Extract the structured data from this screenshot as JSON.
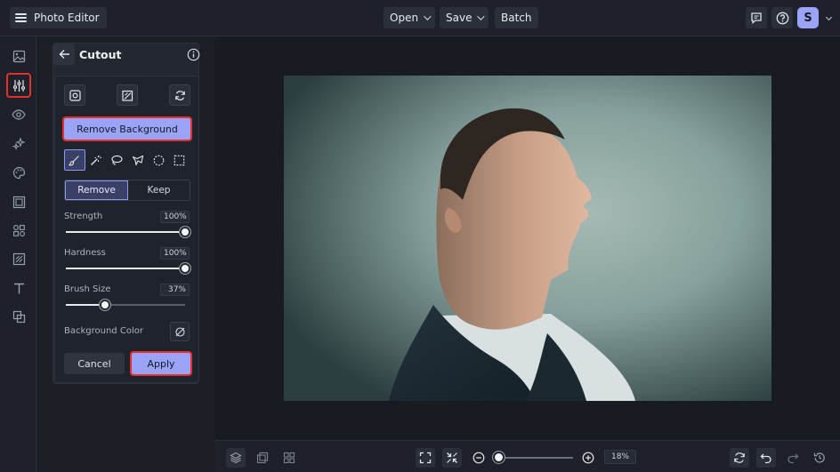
{
  "app": {
    "title": "Photo Editor"
  },
  "topbar": {
    "open_label": "Open",
    "save_label": "Save",
    "batch_label": "Batch",
    "avatar_letter": "S",
    "icons": [
      "menu-icon",
      "chat-icon",
      "help-icon",
      "chevron-down-icon"
    ]
  },
  "rail": {
    "items": [
      "image-icon",
      "adjustments-icon",
      "eye-icon",
      "sparkle-effects-icon",
      "palette-icon",
      "frame-icon",
      "shapes-icon",
      "texture-icon",
      "text-icon",
      "overlay-icon"
    ],
    "active": "adjustments-icon"
  },
  "panel": {
    "title": "Cutout",
    "mode_icons": [
      "instagram-square-icon",
      "auto-cutout-icon",
      "refresh-icon"
    ],
    "remove_background_label": "Remove Background",
    "tools": [
      "brush-icon",
      "magic-wand-icon",
      "lasso-icon",
      "polygon-lasso-icon",
      "ellipse-select-icon",
      "rect-select-icon"
    ],
    "segment": {
      "remove_label": "Remove",
      "keep_label": "Keep",
      "selected": "Remove"
    },
    "strength": {
      "label": "Strength",
      "value": "100%",
      "level": 1.0
    },
    "hardness": {
      "label": "Hardness",
      "value": "100%",
      "level": 1.0
    },
    "brush_size": {
      "label": "Brush Size",
      "value": "37%",
      "level": 0.33
    },
    "background_color_label": "Background Color",
    "cancel_label": "Cancel",
    "apply_label": "Apply"
  },
  "bottombar": {
    "zoom_value": "18%",
    "zoom_level": 0.05
  },
  "colors": {
    "accent": "#9aa3f5",
    "highlight": "#e3302f",
    "panel_bg": "#232730",
    "app_bg": "#1c1f26"
  }
}
